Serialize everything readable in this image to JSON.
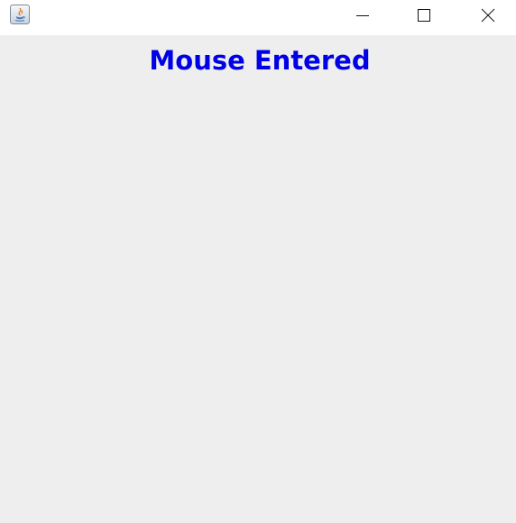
{
  "window": {
    "title": "",
    "controls": {
      "minimize_icon": "minimize-icon",
      "maximize_icon": "maximize-icon",
      "close_icon": "close-icon"
    }
  },
  "content": {
    "status_text": "Mouse Entered",
    "status_color": "#0000e6",
    "background_color": "#eeeeee"
  }
}
